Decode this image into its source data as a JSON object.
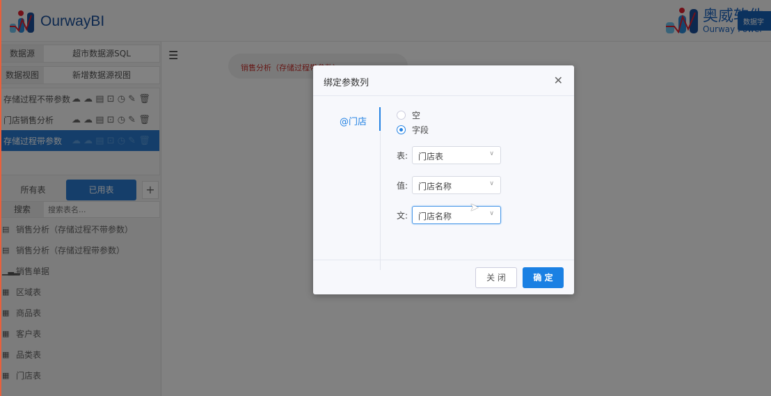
{
  "header": {
    "logo_text": "OurwayBI",
    "brand_cn": "奥威软件",
    "brand_en": "Ourway Power",
    "brand_button": "数据字"
  },
  "sidebar": {
    "datasource_label": "数据源",
    "datasource_value": "超市数据源SQL",
    "dataview_label": "数据视图",
    "dataview_value": "新增数据源视图",
    "datasets": [
      {
        "name": "存储过程不带参数"
      },
      {
        "name": "门店销售分析"
      },
      {
        "name": "存储过程带参数",
        "selected": true
      }
    ],
    "tabs": [
      "所有表",
      "已用表"
    ],
    "add_label": "+",
    "search_label": "搜索",
    "search_placeholder": "搜索表名...",
    "tables": [
      {
        "icon": "view-icon",
        "name": "销售分析（存储过程不带参数）"
      },
      {
        "icon": "view-icon",
        "name": "销售分析（存储过程带参数）"
      },
      {
        "icon": "bar-chart-icon",
        "name": "销售单据"
      },
      {
        "icon": "table-icon",
        "name": "区域表"
      },
      {
        "icon": "table-icon",
        "name": "商品表"
      },
      {
        "icon": "table-icon",
        "name": "客户表"
      },
      {
        "icon": "table-icon",
        "name": "品类表"
      },
      {
        "icon": "table-icon",
        "name": "门店表"
      }
    ]
  },
  "main": {
    "chip": "销售分析（存储过程带参数）"
  },
  "dialog": {
    "title": "绑定参数列",
    "param_tab": "@门店",
    "radio_empty": "空",
    "radio_field": "字段",
    "table_label": "表:",
    "table_value": "门店表",
    "value_label": "值:",
    "value_value": "门店名称",
    "text_label": "文:",
    "text_value": "门店名称",
    "cancel": "关 闭",
    "ok": "确 定"
  }
}
